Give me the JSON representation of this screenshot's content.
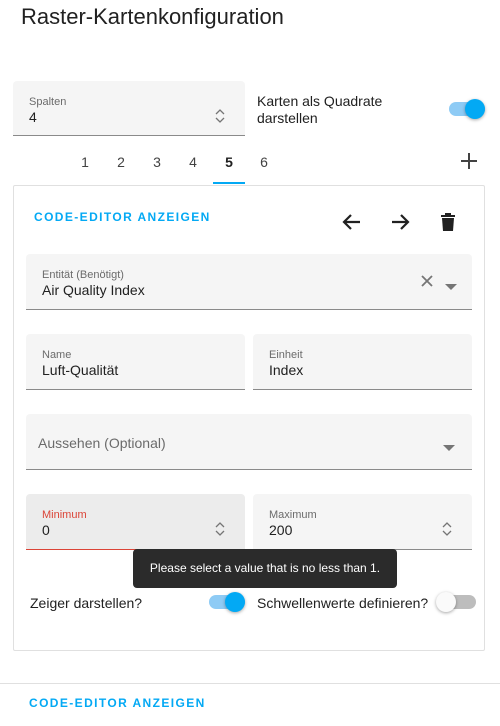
{
  "page": {
    "title": "Raster-Kartenkonfiguration"
  },
  "grid": {
    "columns_label": "Spalten",
    "columns_value": "4",
    "square_label": "Karten als Quadrate darstellen",
    "square_on": true
  },
  "tabs": {
    "items": [
      "1",
      "2",
      "3",
      "4",
      "5",
      "6"
    ],
    "active": "5",
    "add_icon": "plus-icon"
  },
  "card": {
    "code_editor_label": "CODE-EDITOR ANZEIGEN",
    "icons": [
      "arrow-left-icon",
      "arrow-right-icon",
      "delete-icon"
    ],
    "entity": {
      "label": "Entität (Benötigt)",
      "value": "Air Quality Index"
    },
    "name": {
      "label": "Name",
      "value": "Luft-Qualität"
    },
    "unit": {
      "label": "Einheit",
      "value": "Index"
    },
    "appearance": {
      "placeholder": "Aussehen (Optional)"
    },
    "minimum": {
      "label": "Minimum",
      "value": "0"
    },
    "maximum": {
      "label": "Maximum",
      "value": "200"
    },
    "tooltip": "Please select a value that is no less than 1.",
    "needle": {
      "label": "Zeiger darstellen?",
      "on": true
    },
    "severity": {
      "label": "Schwellenwerte definieren?",
      "on": false
    }
  },
  "footer": {
    "code_editor_label": "CODE-EDITOR ANZEIGEN"
  },
  "colors": {
    "accent": "#03a9f4",
    "error": "#db4437",
    "field_bg": "#f5f5f5"
  }
}
